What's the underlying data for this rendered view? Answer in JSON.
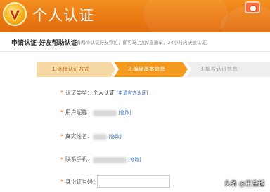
{
  "header": {
    "logo_icon": "v-logo-icon",
    "title": "个人认证",
    "camera_icon": "camera-icon"
  },
  "subheader": {
    "title": "申请认证-好友帮助认证",
    "description": "（有两个认证好友帮忙，即可马上加V直通车，24小时内快速认证）"
  },
  "steps": [
    {
      "label": "1.选择认证方式",
      "state": "done"
    },
    {
      "label": "2.编辑基本信息",
      "state": "active"
    },
    {
      "label": "3.填写认证信息",
      "state": "pending"
    }
  ],
  "form": {
    "type_label": "认证类型：",
    "type_value": "个人认证",
    "type_link": "[申请官方认证]",
    "nickname_label": "用户昵称：",
    "nickname_link": "[修改]",
    "realname_label": "真实姓名：",
    "realname_link": "[修改]",
    "phone_label": "联系手机：",
    "phone_link": "[修改]",
    "id_label": "身份证号码："
  },
  "watermark": "头条 @王岳越",
  "colors": {
    "header_orange": "#ea7a14",
    "step_active": "#f39a1e",
    "link_blue": "#3b6fc2"
  }
}
